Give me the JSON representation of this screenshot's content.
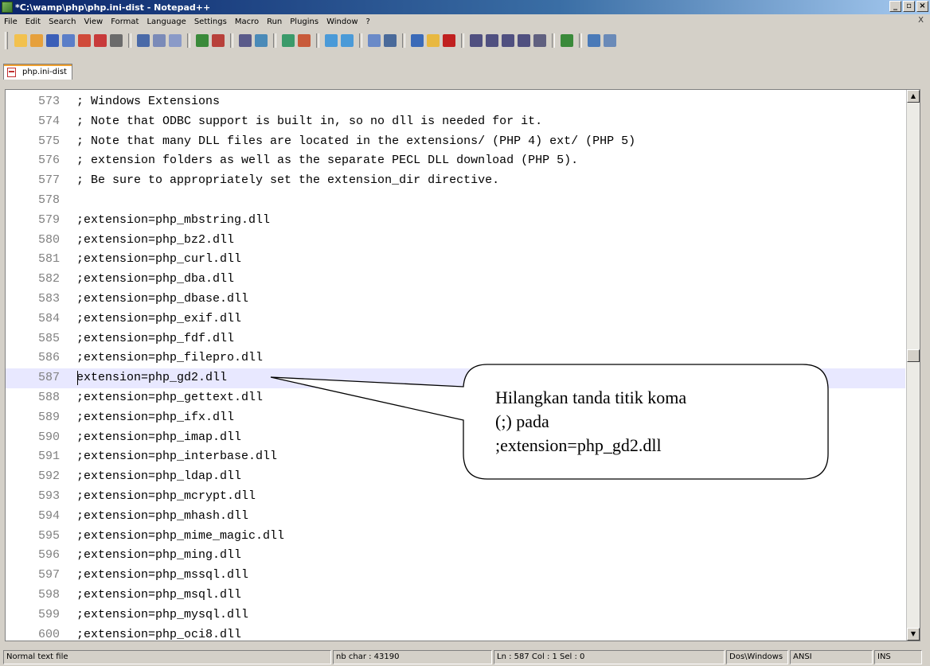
{
  "window": {
    "title": "*C:\\wamp\\php\\php.ini-dist - Notepad++",
    "minimize_label": "_",
    "maximize_label": "▫",
    "close_label": "×"
  },
  "menu": {
    "items": [
      "File",
      "Edit",
      "Search",
      "View",
      "Format",
      "Language",
      "Settings",
      "Macro",
      "Run",
      "Plugins",
      "Window",
      "?"
    ],
    "close_label": "X"
  },
  "toolbar": {
    "buttons": [
      "new-icon",
      "open-icon",
      "save-icon",
      "save-all-icon",
      "close-icon",
      "close-all-icon",
      "print-icon",
      "cut-icon",
      "copy-icon",
      "paste-icon",
      "undo-icon",
      "redo-icon",
      "find-icon",
      "replace-icon",
      "zoom-in-icon",
      "zoom-out-icon",
      "sync-v-icon",
      "sync-h-icon",
      "wrap-icon",
      "all-chars-icon",
      "indent-guide-icon",
      "doc-map-icon",
      "record-icon",
      "stop-icon",
      "play-icon",
      "play-multi-icon",
      "save-macro-icon",
      "run-icon",
      "spell-icon",
      "panel-icon",
      "settings-icon"
    ]
  },
  "tab": {
    "label": "php.ini-dist"
  },
  "editor": {
    "current_line": "587",
    "lines": [
      {
        "num": "573",
        "text": "; Windows Extensions"
      },
      {
        "num": "574",
        "text": "; Note that ODBC support is built in, so no dll is needed for it."
      },
      {
        "num": "575",
        "text": "; Note that many DLL files are located in the extensions/ (PHP 4) ext/ (PHP 5)"
      },
      {
        "num": "576",
        "text": "; extension folders as well as the separate PECL DLL download (PHP 5)."
      },
      {
        "num": "577",
        "text": "; Be sure to appropriately set the extension_dir directive."
      },
      {
        "num": "578",
        "text": ""
      },
      {
        "num": "579",
        "text": ";extension=php_mbstring.dll"
      },
      {
        "num": "580",
        "text": ";extension=php_bz2.dll"
      },
      {
        "num": "581",
        "text": ";extension=php_curl.dll"
      },
      {
        "num": "582",
        "text": ";extension=php_dba.dll"
      },
      {
        "num": "583",
        "text": ";extension=php_dbase.dll"
      },
      {
        "num": "584",
        "text": ";extension=php_exif.dll"
      },
      {
        "num": "585",
        "text": ";extension=php_fdf.dll"
      },
      {
        "num": "586",
        "text": ";extension=php_filepro.dll"
      },
      {
        "num": "587",
        "text": "extension=php_gd2.dll"
      },
      {
        "num": "588",
        "text": ";extension=php_gettext.dll"
      },
      {
        "num": "589",
        "text": ";extension=php_ifx.dll"
      },
      {
        "num": "590",
        "text": ";extension=php_imap.dll"
      },
      {
        "num": "591",
        "text": ";extension=php_interbase.dll"
      },
      {
        "num": "592",
        "text": ";extension=php_ldap.dll"
      },
      {
        "num": "593",
        "text": ";extension=php_mcrypt.dll"
      },
      {
        "num": "594",
        "text": ";extension=php_mhash.dll"
      },
      {
        "num": "595",
        "text": ";extension=php_mime_magic.dll"
      },
      {
        "num": "596",
        "text": ";extension=php_ming.dll"
      },
      {
        "num": "597",
        "text": ";extension=php_mssql.dll"
      },
      {
        "num": "598",
        "text": ";extension=php_msql.dll"
      },
      {
        "num": "599",
        "text": ";extension=php_mysql.dll"
      },
      {
        "num": "600",
        "text": ";extension=php_oci8.dll"
      }
    ]
  },
  "callout": {
    "lines": [
      "Hilangkan tanda titik koma",
      "(;) pada",
      ";extension=php_gd2.dll"
    ]
  },
  "status": {
    "filetype": "Normal text file",
    "nb_char": "nb char : 43190",
    "position": "Ln : 587   Col : 1   Sel : 0",
    "eol": "Dos\\Windows",
    "encoding": "ANSI",
    "mode": "INS"
  }
}
